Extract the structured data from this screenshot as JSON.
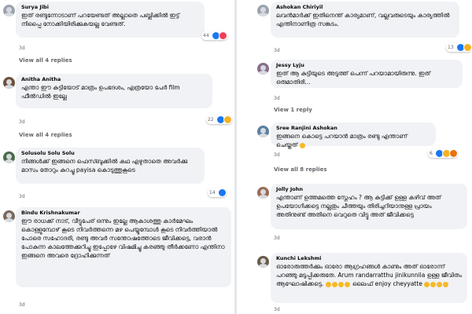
{
  "left": [
    {
      "name": "Surya Jibi",
      "text": "ഇത് രണ്ടുന്നോടാണ് പറയേണ്ടത് അല്ലാതെ പബ്ലിക്കിൽ ഇട്ട് നിപ്പൈ നോക്കിയിരിക്കുകയല്ല വേണ്ടത്.",
      "time": "3d",
      "reaction_count": "44",
      "replies": "View all 4 replies"
    },
    {
      "name": "Anitha Anitha",
      "text": "എന്താ ഈ കുട്ടിയോട് മാത്രം ഉപദേശം, എത്രയോ പേർ film ഫീൽഡിൽ ഇല്ലേ",
      "time": "3d",
      "reaction_count": "22",
      "replies": "View all 4 replies"
    },
    {
      "name": "Solusolu Solu Solu",
      "text": "നിങ്ങൾക്ക് ഇങ്ങനെ ഫെസ്ബുക്കിൽ കഥ എഴുതാതെ അവർക്കു മാസം തോറും കുറച്ചു payisa കൊടുത്തുകൂടെ",
      "time": "3d",
      "reaction_count": "14"
    },
    {
      "name": "Bindu Krishnakumar",
      "text": "ഈ രാധക്ക് നാട്, വീട്ടുപേര് ഒന്നും ഇല്ലേ ആകാശത്തു കാർമേഘം കൊള്ളുമ്പോഴ് കൂടെ നിവർത്തന്നെ മഴ പെയ്യുമ്പോൾ കൂടെ നിവർത്തിയാൽ പോരെ സഹോദരി, രണ്ടു അവർ സന്തോഷത്തോടെ ജീവിക്കട്ടെ, വരാൻ പോകുന്ന കാലത്തേക്കുറിച്ചു ഇപ്പോഴേ വിഷമിച്ചു കരഞ്ഞു തീർക്കണോ എന്തിനാ ഇങ്ങനെ അവരെ ദ്രോഹിക്കുന്നത്",
      "time": "3d"
    }
  ],
  "right": [
    {
      "name": "Ashokan Chiriyil",
      "text": "ലവൻമാർക്ക് ഇതിനെന്ത് കാര്യമാണ്, വല്ലവരുടെയും കാര്യത്തിൽ എന്തിനാണിത്ര സങ്കടം.",
      "time": "3d",
      "reaction_count": "13"
    },
    {
      "name": "Jessy Lyju",
      "text": "ഇത് ആ കുട്ടിയുടെ അടുത്ത് പെന്ന് പറയാമായിരുന്നു. ഇത് ഒരുമാതിരി...",
      "time": "3d",
      "replies": "View 1 reply"
    },
    {
      "name": "Sree Ranjini Ashokan",
      "text": "ഇങ്ങനെ കൊട്ടെ പറയാൻ മാത്രം രണ്ടു എന്താണ് ചെയ്തത്",
      "time": "3d",
      "reaction_count": "6",
      "replies": "View all 8 replies"
    },
    {
      "name": "Jolly John",
      "text": "എന്താണ് ഉത്തമത്തെ സ്നേഹം ? ആ കുട്ടിക്ക് ഉള്ള കഴിവ് അത് ഉപയോഗിക്കട്ടെ നല്ലതും ചീത്തയും തിരിച്ചറിയാനുള്ള പ്രായം അതിനുണ്ട് അതിനെ വെറുതെ വിട്ടു അത് ജീവിക്കട്ടെ",
      "time": "3d"
    },
    {
      "name": "Kunchi Lekshmi",
      "text_main": "ഓരോരുത്തർക്കും ഓരോ ആഗ്രഹങ്ങൾ കാണും അത് ഓരോന്ന് പറഞ്ഞു മടുപ്പിക്കരുതേ. Arum randarratthu jinikunnila ഉള്ള ജീവിതം ആഘോഷിക്കട്ടെ.",
      "text_tail": "ലൈഫ് enjoy cheyyatte",
      "time": "3d"
    }
  ],
  "colors": {
    "bubble": "#f0f2f5",
    "meta": "#65676b",
    "like": "#1877f2",
    "love": "#f33e58"
  }
}
